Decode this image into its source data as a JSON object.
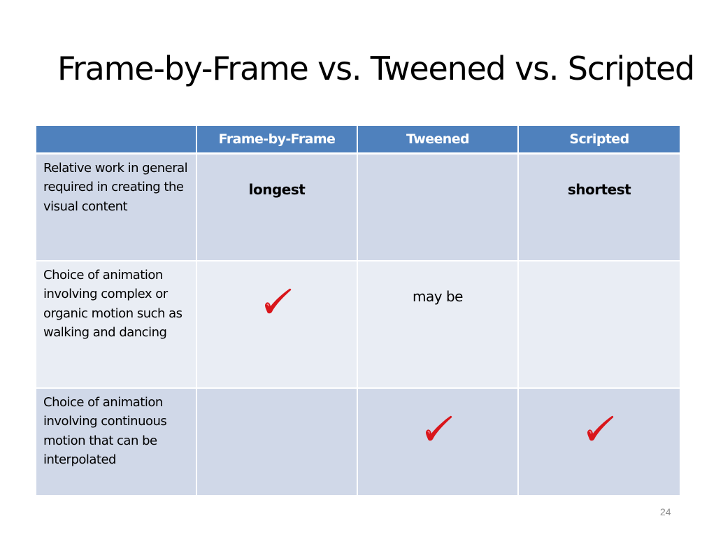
{
  "slide": {
    "title": "Frame-by-Frame vs. Tweened vs. Scripted",
    "page_number": "24"
  },
  "colors": {
    "header_bg": "#4f81bd",
    "row_dark_bg": "#d0d8e8",
    "row_light_bg": "#e9edf4",
    "check_color": "#d9161b"
  },
  "table": {
    "headers": [
      "",
      "Frame-by-Frame",
      "Tweened",
      "Scripted"
    ],
    "rows": [
      {
        "label": "Relative work in general required in creating the visual content",
        "cells": [
          {
            "type": "text",
            "value": "longest",
            "bold": true
          },
          {
            "type": "empty",
            "value": ""
          },
          {
            "type": "text",
            "value": "shortest",
            "bold": true
          }
        ]
      },
      {
        "label": "Choice of animation involving complex or organic motion such as walking and dancing",
        "cells": [
          {
            "type": "icon",
            "icon": "checkmark-icon"
          },
          {
            "type": "text",
            "value": "may be",
            "bold": false
          },
          {
            "type": "empty",
            "value": ""
          }
        ]
      },
      {
        "label": "Choice of animation involving continuous motion that can be interpolated",
        "cells": [
          {
            "type": "empty",
            "value": ""
          },
          {
            "type": "icon",
            "icon": "checkmark-icon"
          },
          {
            "type": "icon",
            "icon": "checkmark-icon"
          }
        ]
      }
    ]
  }
}
